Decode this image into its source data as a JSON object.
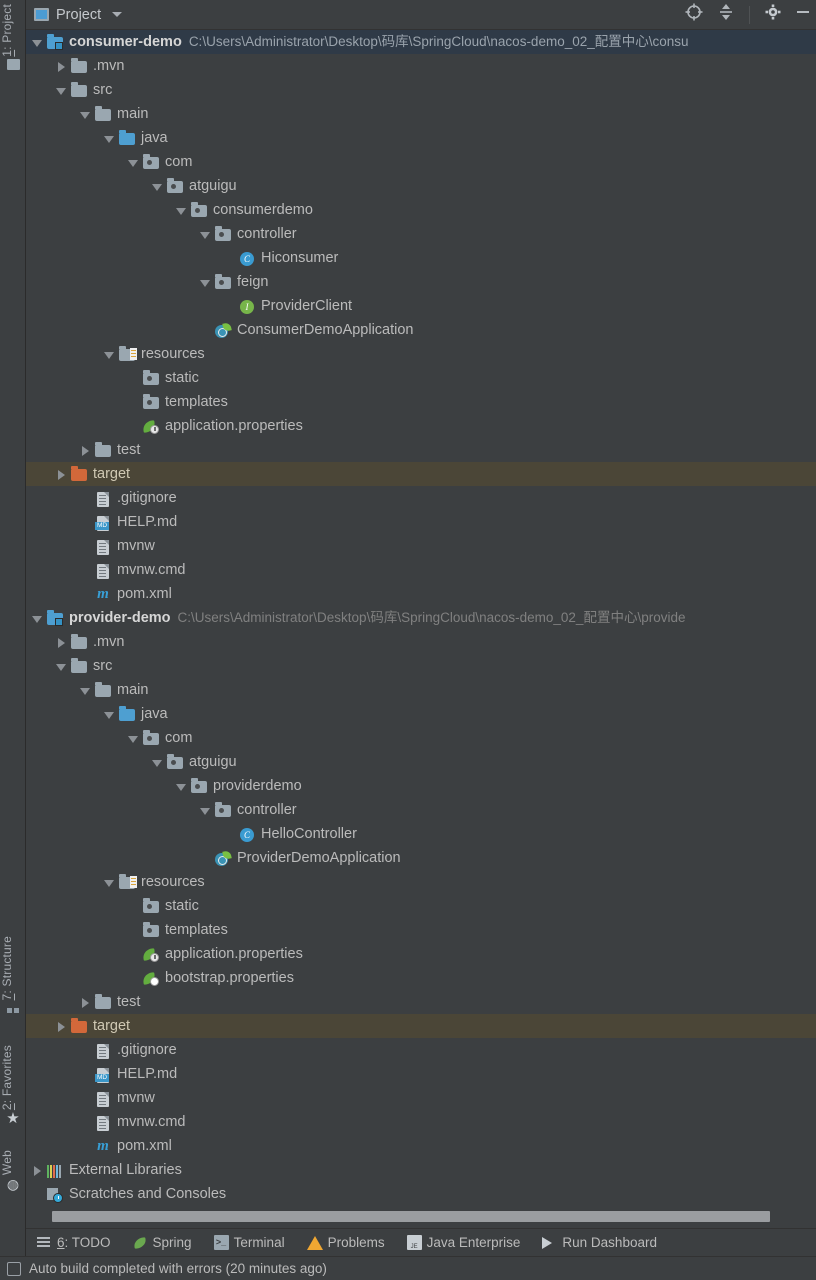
{
  "window": {
    "tool_window_title": "Project",
    "background": "#3c3f41",
    "selection_root": "#2f3a47",
    "selection_target": "#4b4637"
  },
  "header": {
    "title": "Project",
    "icons": [
      {
        "name": "locate-icon",
        "glyph": "target"
      },
      {
        "name": "collapse-all-icon",
        "glyph": "collapse"
      },
      {
        "name": "settings-gear-icon",
        "glyph": "gear"
      },
      {
        "name": "hide-icon",
        "glyph": "minus"
      }
    ]
  },
  "left_sidebar": {
    "top": [
      {
        "label": "1: Project",
        "underline": "1",
        "icon": "project-folder-icon"
      }
    ],
    "bottom": [
      {
        "label": "7: Structure",
        "underline": "7",
        "icon": "structure-icon"
      },
      {
        "label": "2: Favorites",
        "underline": "2",
        "icon": "star-icon"
      },
      {
        "label": "Web",
        "underline": "",
        "icon": "globe-icon"
      }
    ]
  },
  "tree": [
    {
      "depth": 0,
      "toggle": "open",
      "icon": "module-folder",
      "label": "consumer-demo",
      "bold": true,
      "path": "C:\\Users\\Administrator\\Desktop\\码库\\SpringCloud\\nacos-demo_02_配置中心\\consu",
      "state": "selected-root"
    },
    {
      "depth": 1,
      "toggle": "closed",
      "icon": "folder",
      "label": ".mvn"
    },
    {
      "depth": 1,
      "toggle": "open",
      "icon": "folder",
      "label": "src"
    },
    {
      "depth": 2,
      "toggle": "open",
      "icon": "folder",
      "label": "main"
    },
    {
      "depth": 3,
      "toggle": "open",
      "icon": "folder-source",
      "label": "java"
    },
    {
      "depth": 4,
      "toggle": "open",
      "icon": "package",
      "label": "com"
    },
    {
      "depth": 5,
      "toggle": "open",
      "icon": "package",
      "label": "atguigu"
    },
    {
      "depth": 6,
      "toggle": "open",
      "icon": "package",
      "label": "consumerdemo"
    },
    {
      "depth": 7,
      "toggle": "open",
      "icon": "package",
      "label": "controller"
    },
    {
      "depth": 8,
      "toggle": "none",
      "icon": "class",
      "label": "Hiconsumer"
    },
    {
      "depth": 7,
      "toggle": "open",
      "icon": "package",
      "label": "feign"
    },
    {
      "depth": 8,
      "toggle": "none",
      "icon": "interface",
      "label": "ProviderClient"
    },
    {
      "depth": 7,
      "toggle": "none",
      "icon": "spring-boot-app",
      "label": "ConsumerDemoApplication"
    },
    {
      "depth": 3,
      "toggle": "open",
      "icon": "folder-resources",
      "label": "resources"
    },
    {
      "depth": 4,
      "toggle": "none",
      "icon": "package",
      "label": "static"
    },
    {
      "depth": 4,
      "toggle": "none",
      "icon": "package",
      "label": "templates"
    },
    {
      "depth": 4,
      "toggle": "none",
      "icon": "spring-properties",
      "label": "application.properties"
    },
    {
      "depth": 2,
      "toggle": "closed",
      "icon": "folder",
      "label": "test"
    },
    {
      "depth": 1,
      "toggle": "closed",
      "icon": "folder-excluded",
      "label": "target",
      "state": "highlighted-target"
    },
    {
      "depth": 2,
      "toggle": "none",
      "icon": "file-text",
      "label": ".gitignore"
    },
    {
      "depth": 2,
      "toggle": "none",
      "icon": "file-markdown",
      "label": "HELP.md"
    },
    {
      "depth": 2,
      "toggle": "none",
      "icon": "file-text",
      "label": "mvnw"
    },
    {
      "depth": 2,
      "toggle": "none",
      "icon": "file-text",
      "label": "mvnw.cmd"
    },
    {
      "depth": 2,
      "toggle": "none",
      "icon": "file-maven",
      "label": "pom.xml"
    },
    {
      "depth": 0,
      "toggle": "open",
      "icon": "module-folder",
      "label": "provider-demo",
      "bold": true,
      "path": "C:\\Users\\Administrator\\Desktop\\码库\\SpringCloud\\nacos-demo_02_配置中心\\provide"
    },
    {
      "depth": 1,
      "toggle": "closed",
      "icon": "folder",
      "label": ".mvn"
    },
    {
      "depth": 1,
      "toggle": "open",
      "icon": "folder",
      "label": "src"
    },
    {
      "depth": 2,
      "toggle": "open",
      "icon": "folder",
      "label": "main"
    },
    {
      "depth": 3,
      "toggle": "open",
      "icon": "folder-source",
      "label": "java"
    },
    {
      "depth": 4,
      "toggle": "open",
      "icon": "package",
      "label": "com"
    },
    {
      "depth": 5,
      "toggle": "open",
      "icon": "package",
      "label": "atguigu"
    },
    {
      "depth": 6,
      "toggle": "open",
      "icon": "package",
      "label": "providerdemo"
    },
    {
      "depth": 7,
      "toggle": "open",
      "icon": "package",
      "label": "controller"
    },
    {
      "depth": 8,
      "toggle": "none",
      "icon": "class",
      "label": "HelloController"
    },
    {
      "depth": 7,
      "toggle": "none",
      "icon": "spring-boot-app",
      "label": "ProviderDemoApplication"
    },
    {
      "depth": 3,
      "toggle": "open",
      "icon": "folder-resources",
      "label": "resources"
    },
    {
      "depth": 4,
      "toggle": "none",
      "icon": "package",
      "label": "static"
    },
    {
      "depth": 4,
      "toggle": "none",
      "icon": "package",
      "label": "templates"
    },
    {
      "depth": 4,
      "toggle": "none",
      "icon": "spring-properties",
      "label": "application.properties"
    },
    {
      "depth": 4,
      "toggle": "none",
      "icon": "spring-cloud-properties",
      "label": "bootstrap.properties"
    },
    {
      "depth": 2,
      "toggle": "closed",
      "icon": "folder",
      "label": "test"
    },
    {
      "depth": 1,
      "toggle": "closed",
      "icon": "folder-excluded",
      "label": "target",
      "state": "highlighted-target"
    },
    {
      "depth": 2,
      "toggle": "none",
      "icon": "file-text",
      "label": ".gitignore"
    },
    {
      "depth": 2,
      "toggle": "none",
      "icon": "file-markdown",
      "label": "HELP.md"
    },
    {
      "depth": 2,
      "toggle": "none",
      "icon": "file-text",
      "label": "mvnw"
    },
    {
      "depth": 2,
      "toggle": "none",
      "icon": "file-text",
      "label": "mvnw.cmd"
    },
    {
      "depth": 2,
      "toggle": "none",
      "icon": "file-maven",
      "label": "pom.xml"
    },
    {
      "depth": 0,
      "toggle": "closed",
      "icon": "external-libraries",
      "label": "External Libraries"
    },
    {
      "depth": 0,
      "toggle": "none",
      "icon": "scratches",
      "label": "Scratches and Consoles"
    }
  ],
  "bottom_toolbar": [
    {
      "label": "6: TODO",
      "underline": "6",
      "icon": "todo-list-icon"
    },
    {
      "label": "Spring",
      "icon": "spring-leaf-icon"
    },
    {
      "label": "Terminal",
      "icon": "terminal-icon"
    },
    {
      "label": "Problems",
      "icon": "warning-triangle-icon"
    },
    {
      "label": "Java Enterprise",
      "icon": "java-enterprise-icon"
    },
    {
      "label": "Run Dashboard",
      "icon": "run-play-icon"
    }
  ],
  "status_bar": {
    "icon": "build-icon",
    "message": "Auto build completed with errors (20 minutes ago)"
  }
}
